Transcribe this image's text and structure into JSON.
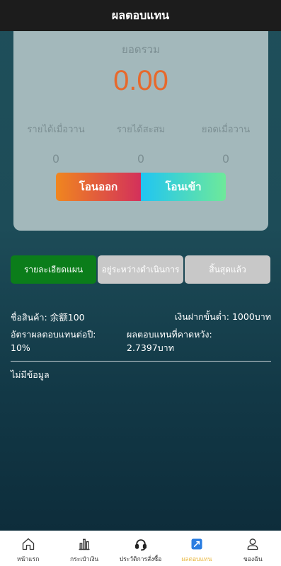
{
  "header": {
    "title": "ผลตอบแทน"
  },
  "summary": {
    "total_label": "ยอดรวม",
    "total_value": "0.00",
    "stats": [
      {
        "label": "รายได้เมื่อวาน",
        "value": "0"
      },
      {
        "label": "รายได้สะสม",
        "value": "0"
      },
      {
        "label": "ยอดเมื่อวาน",
        "value": "0"
      }
    ],
    "transfer_out_label": "โอนออก",
    "transfer_in_label": "โอนเข้า"
  },
  "tabs": [
    {
      "label": "รายละเอียดแผน",
      "active": true
    },
    {
      "label": "อยู่ระหว่างดำเนินการ",
      "active": false
    },
    {
      "label": "สิ้นสุดแล้ว",
      "active": false
    }
  ],
  "plan": {
    "product_label": "ชื่อสินค้า:",
    "product_value": "余额100",
    "min_deposit_label": "เงินฝากขั้นต่ำ:",
    "min_deposit_value": "1000บาท",
    "annual_rate_label": "อัตราผลตอบแทนต่อปี:",
    "annual_rate_value": "10%",
    "expected_return_label": "ผลตอบแทนที่คาดหวัง:",
    "expected_return_value": "2.7397บาท"
  },
  "no_data": "ไม่มีข้อมูล",
  "nav": [
    {
      "label": "หน้าแรก",
      "icon": "home-icon",
      "active": false
    },
    {
      "label": "กระเป๋าเงิน",
      "icon": "bar-chart-icon",
      "active": false
    },
    {
      "label": "ประวัติการสั่งซื้อ",
      "icon": "headset-icon",
      "active": false
    },
    {
      "label": "ผลตอบแทน",
      "icon": "trend-icon",
      "active": true
    },
    {
      "label": "ของฉัน",
      "icon": "user-icon",
      "active": false
    }
  ],
  "colors": {
    "accent_orange": "#e7692c",
    "active_tab": "#0b7d1a",
    "nav_active": "#e8b73e",
    "nav_active_icon": "#2a7de1"
  }
}
